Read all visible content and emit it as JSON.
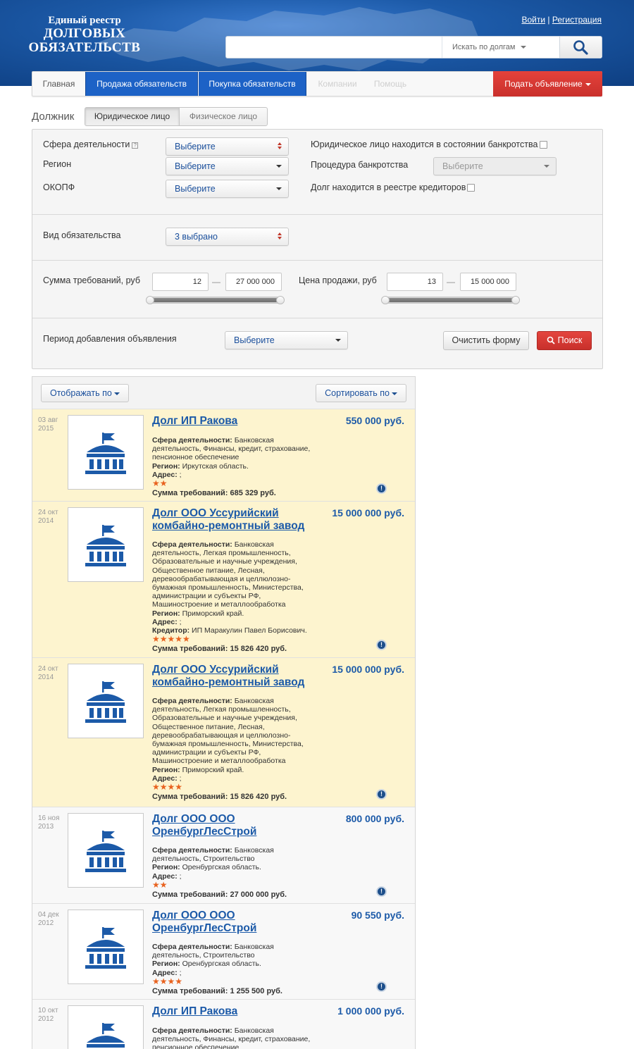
{
  "header": {
    "logo_line1": "Единый реестр",
    "logo_line2": "ДОЛГОВЫХ",
    "logo_line3": "ОБЯЗАТЕЛЬСТВ",
    "login": "Войти",
    "auth_sep": "|",
    "register": "Регистрация",
    "search_value": "",
    "search_scope": "Искать по долгам"
  },
  "nav": {
    "home": "Главная",
    "sell": "Продажа обязательств",
    "buy": "Покупка обязательств",
    "companies": "Компании",
    "help": "Помощь",
    "post_ad": "Подать объявление"
  },
  "debtor": {
    "label": "Должник",
    "legal": "Юридическое лицо",
    "physical": "Физическое лицо"
  },
  "filters": {
    "sphere_label": "Сфера деятельности",
    "sphere_value": "Выберите",
    "region_label": "Регион",
    "region_value": "Выберите",
    "okopf_label": "ОКОПФ",
    "okopf_value": "Выберите",
    "bankrupt_label": "Юридическое лицо находится в состоянии банкротства",
    "procedure_label": "Процедура банкротства",
    "procedure_value": "Выберите",
    "registry_label": "Долг находится в реестре кредиторов",
    "obligation_label": "Вид обязательства",
    "obligation_value": "3 выбрано",
    "claims_label": "Сумма требований, руб",
    "claims_min": "12",
    "claims_max": "27 000 000",
    "price_label": "Цена продажи, руб",
    "price_min": "13",
    "price_max": "15 000 000",
    "dash": "—",
    "period_label": "Период добавления объявления",
    "period_value": "Выберите",
    "clear": "Очистить форму",
    "search": "Поиск"
  },
  "results": {
    "display_by": "Отображать по",
    "sort_by": "Сортировать по",
    "items": [
      {
        "date_day": "03 авг",
        "date_year": "2015",
        "title": "Долг ИП Ракова",
        "price": "550 000 руб.",
        "sphere_key": "Сфера деятельности:",
        "sphere": "Банковская деятельность, Финансы, кредит, страхование, пенсионное обеспечение",
        "region_key": "Регион:",
        "region": "Иркутская область.",
        "address_key": "Адрес:",
        "address": ";",
        "creditor_key": "",
        "creditor": "",
        "stars": "★★",
        "sum_key": "Сумма требований:",
        "sum": "685 329 руб."
      },
      {
        "date_day": "24 окт",
        "date_year": "2014",
        "title": "Долг ООО Уссурийский комбайно-ремонтный завод",
        "price": "15 000 000 руб.",
        "sphere_key": "Сфера деятельности:",
        "sphere": "Банковская деятельность, Легкая промышленность, Образовательные и научные учреждения, Общественное питание, Лесная, деревообрабатывающая и целлюлозно-бумажная промышленность, Министерства, администрации и субъекты РФ, Машиностроение и металлообработка",
        "region_key": "Регион:",
        "region": "Приморский край.",
        "address_key": "Адрес:",
        "address": ";",
        "creditor_key": "Кредитор:",
        "creditor": "ИП Маракулин Павел Борисович.",
        "stars": "★★★★★",
        "sum_key": "Сумма требований:",
        "sum": "15 826 420 руб."
      },
      {
        "date_day": "24 окт",
        "date_year": "2014",
        "title": "Долг ООО Уссурийский комбайно-ремонтный завод",
        "price": "15 000 000 руб.",
        "sphere_key": "Сфера деятельности:",
        "sphere": "Банковская деятельность, Легкая промышленность, Образовательные и научные учреждения, Общественное питание, Лесная, деревообрабатывающая и целлюлозно-бумажная промышленность, Министерства, администрации и субъекты РФ, Машиностроение и металлообработка",
        "region_key": "Регион:",
        "region": "Приморский край.",
        "address_key": "Адрес:",
        "address": ";",
        "creditor_key": "",
        "creditor": "",
        "stars": "★★★★",
        "sum_key": "Сумма требований:",
        "sum": "15 826 420 руб."
      },
      {
        "date_day": "16 ноя",
        "date_year": "2013",
        "title": "Долг ООО ООО ОренбургЛесСтрой",
        "price": "800 000 руб.",
        "sphere_key": "Сфера деятельности:",
        "sphere": "Банковская деятельность, Строительство",
        "region_key": "Регион:",
        "region": "Оренбургская область.",
        "address_key": "Адрес:",
        "address": ";",
        "creditor_key": "",
        "creditor": "",
        "stars": "★★",
        "sum_key": "Сумма требований:",
        "sum": "27 000 000 руб."
      },
      {
        "date_day": "04 дек",
        "date_year": "2012",
        "title": "Долг ООО ООО ОренбургЛесСтрой",
        "price": "90 550 руб.",
        "sphere_key": "Сфера деятельности:",
        "sphere": "Банковская деятельность, Строительство",
        "region_key": "Регион:",
        "region": "Оренбургская область.",
        "address_key": "Адрес:",
        "address": ";",
        "creditor_key": "",
        "creditor": "",
        "stars": "★★★★",
        "sum_key": "Сумма требований:",
        "sum": "1 255 500 руб."
      },
      {
        "date_day": "10 окт",
        "date_year": "2012",
        "title": "Долг ИП Ракова",
        "price": "1 000 000 руб.",
        "sphere_key": "Сфера деятельности:",
        "sphere": "Банковская деятельность, Финансы, кредит, страхование, пенсионное обеспечение",
        "region_key": "",
        "region": "",
        "address_key": "",
        "address": "",
        "creditor_key": "",
        "creditor": "",
        "stars": "",
        "sum_key": "",
        "sum": ""
      }
    ]
  },
  "colors": {
    "brand_blue": "#1d62c6",
    "link_blue": "#1c5aa8",
    "accent_red": "#d9383a",
    "highlight": "#fdf4cf",
    "stars": "#e8621f"
  }
}
